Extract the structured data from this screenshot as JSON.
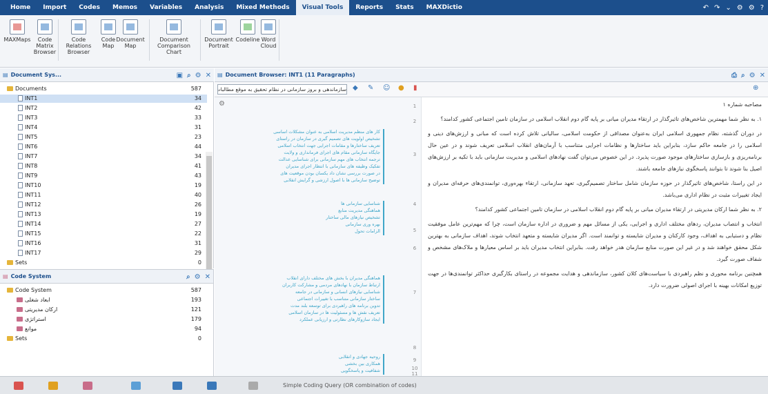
{
  "menubar": {
    "items": [
      "Home",
      "Import",
      "Codes",
      "Memos",
      "Variables",
      "Analysis",
      "Mixed Methods",
      "Visual Tools",
      "Reports",
      "Stats",
      "MAXDictio"
    ],
    "active": "Visual Tools"
  },
  "ribbon": {
    "buttons": [
      {
        "label": "MAXMaps",
        "icon": "maxmaps-icon"
      },
      {
        "label": "Code Matrix Browser",
        "icon": "code-matrix-icon"
      },
      {
        "label": "Code Relations Browser",
        "icon": "code-relations-icon"
      },
      {
        "label": "Code Map",
        "icon": "code-map-icon"
      },
      {
        "label": "Document Map",
        "icon": "document-map-icon"
      },
      {
        "label": "Document Comparison Chart",
        "icon": "document-comparison-icon"
      },
      {
        "label": "Document Portrait",
        "icon": "document-portrait-icon"
      },
      {
        "label": "Codeline",
        "icon": "codeline-icon"
      },
      {
        "label": "Word Cloud",
        "icon": "word-cloud-icon"
      }
    ]
  },
  "docsys": {
    "title": "Document Sys...",
    "rows": [
      {
        "label": "Documents",
        "count": "587",
        "kind": "folder"
      },
      {
        "label": "INT1",
        "count": "34",
        "kind": "doc"
      },
      {
        "label": "INT2",
        "count": "42",
        "kind": "doc"
      },
      {
        "label": "INT3",
        "count": "33",
        "kind": "doc"
      },
      {
        "label": "INT4",
        "count": "31",
        "kind": "doc"
      },
      {
        "label": "INT5",
        "count": "23",
        "kind": "doc"
      },
      {
        "label": "INT6",
        "count": "44",
        "kind": "doc"
      },
      {
        "label": "INT7",
        "count": "34",
        "kind": "doc"
      },
      {
        "label": "INT8",
        "count": "41",
        "kind": "doc"
      },
      {
        "label": "INT9",
        "count": "43",
        "kind": "doc"
      },
      {
        "label": "INT10",
        "count": "19",
        "kind": "doc"
      },
      {
        "label": "INT11",
        "count": "40",
        "kind": "doc"
      },
      {
        "label": "INT12",
        "count": "26",
        "kind": "doc"
      },
      {
        "label": "INT13",
        "count": "19",
        "kind": "doc"
      },
      {
        "label": "INT14",
        "count": "27",
        "kind": "doc"
      },
      {
        "label": "INT15",
        "count": "22",
        "kind": "doc"
      },
      {
        "label": "INT16",
        "count": "31",
        "kind": "doc"
      },
      {
        "label": "INT17",
        "count": "29",
        "kind": "doc"
      },
      {
        "label": "Sets",
        "count": "0",
        "kind": "folder"
      }
    ]
  },
  "codesys": {
    "title": "Code System",
    "rows": [
      {
        "label": "Code System",
        "count": "587",
        "kind": "folder"
      },
      {
        "label": "ابعاد شغلی",
        "count": "193",
        "kind": "code"
      },
      {
        "label": "ارکان مدیریتی",
        "count": "121",
        "kind": "code"
      },
      {
        "label": "استراتژی",
        "count": "179",
        "kind": "code"
      },
      {
        "label": "موانع",
        "count": "94",
        "kind": "code"
      },
      {
        "label": "Sets",
        "count": "0",
        "kind": "folder"
      }
    ]
  },
  "browser": {
    "title": "Document Browser: INT1  (11 Paragraphs)",
    "code_select": "سازماندهی و بروز سازمانی در نظام تحقیق به موقع مطالبات"
  },
  "segments": [
    "کار های منظم مدیریت اسلامی به عنوان مشکلات اساسی",
    "تشخیص اولویت های تصمیم گیری در سازمان در راستای",
    "تعریف ساختارها و مقامات اجرایی جهت انتخاب اسلامی",
    "جایگاه سازمانی مقام های اجرای فرمانداری و ولایت",
    "ترجمه انتخاب های مهم سازمانی برای شناسایی عدالت",
    "تفکیک وظیفه های سازمانی با انتظار اجرای مدیران",
    "در صورت بررسی نشان داد یکسان بودن موقعیت های",
    "توضیح سازمانی ها با اصول ارزشی و گرایش انقلابی",
    "شناسایی سازمانی ها",
    "هماهنگی مدیریت منابع",
    "تشخیص نیازهای مالی ساختار",
    "بهره وری سازمانی",
    "الزامات تحول",
    "هماهنگی مدیران با بخش های مختلف دارای انقلاب",
    "ارتباط سازمان با نهادهای مردمی و مشارکت کاربران",
    "شناسایی نیازهای انسانی و سازمانی در جامعه",
    "ساختار سازمانی متناسب با تغییرات اجتماعی",
    "تدوین برنامه های راهبردی برای توسعه بلند مدت",
    "تعریف نقش ها و مسئولیت ها در سازمان اسلامی",
    "ایجاد سازوکارهای نظارتی و ارزیابی عملکرد",
    "روحیه جهادی و انقلابی",
    "همکاری بین بخشی",
    "شفافیت و پاسخگویی"
  ],
  "paragraph_numbers": [
    "1",
    "2",
    "3",
    "4",
    "5",
    "6",
    "7",
    "8",
    "9",
    "10",
    "11"
  ],
  "paragraphs": [
    "مصاحبه شماره ۱",
    "۱. به نظر شما مهمترین شاخص‌های تاثیرگذار در ارتقاء مدیران میانی بر پایه گام دوم انقلاب اسلامی در سازمان تامین اجتماعی کشور کدامند؟",
    "در دوران گذشته، نظام جمهوری اسلامی ایران به‌عنوان مصداقی از حکومت اسلامی، سالیانی تلاش کرده است که مبانی و ارزش‌های دینی و اسلامی را در جامعه حاکم سازد، بنابراین باید ساختارها و نظامات اجرایی متناسب با آرمان‌های انقلاب اسلامی تعریف شوند و در عین حال برنامه‌ریزی و بازسازی ساختارهای موجود صورت پذیرد. در این خصوص می‌توان گفت نهادهای اسلامی و مدیریت سازمانی باید با تکیه بر ارزش‌های اصیل بنا شوند تا بتوانند پاسخگوی نیازهای جامعه باشند.",
    "در این راستا، شاخص‌های تاثیرگذار در حوزه سازمان شامل ساختار تصمیم‌گیری، تعهد سازمانی، ارتقاء بهره‌وری، توانمندی‌های حرفه‌ای مدیران و ایجاد تغییرات مثبت در نظام اداری می‌باشد.",
    "۲. به نظر شما ارکان مدیریتی در ارتقاء مدیران میانی بر پایه گام دوم انقلاب اسلامی در سازمان تامین اجتماعی کشور کدامند؟",
    "انتخاب و انتصاب مدیران، ردهای مختلف اداری و اجرایی، یکی از مسائل مهم و ضروری در اداره سازمان است، چرا که مهم‌ترین عامل موفقیت نظام و دستیابی به اهداف، وجود کارکنان و مدیران شایسته و توانمند است. اگر مدیران شایسته و متعهد انتخاب شوند، اهداف سازمانی به بهترین شکل محقق خواهند شد و در غیر این صورت منابع سازمان هدر خواهد رفت. بنابراین انتخاب مدیران باید بر اساس معیارها و ملاک‌های مشخص و شفاف صورت گیرد.",
    "همچنین برنامه محوری و نظم راهبردی با سیاست‌های کلان کشور، سازماندهی و هدایت مجموعه در راستای بکارگیری حداکثر توانمندی‌ها در جهت توزیع امکانات بهینه با اجرای اصولی ضرورت دارد."
  ],
  "status": {
    "text": "Simple Coding Query (OR combination of codes)"
  }
}
